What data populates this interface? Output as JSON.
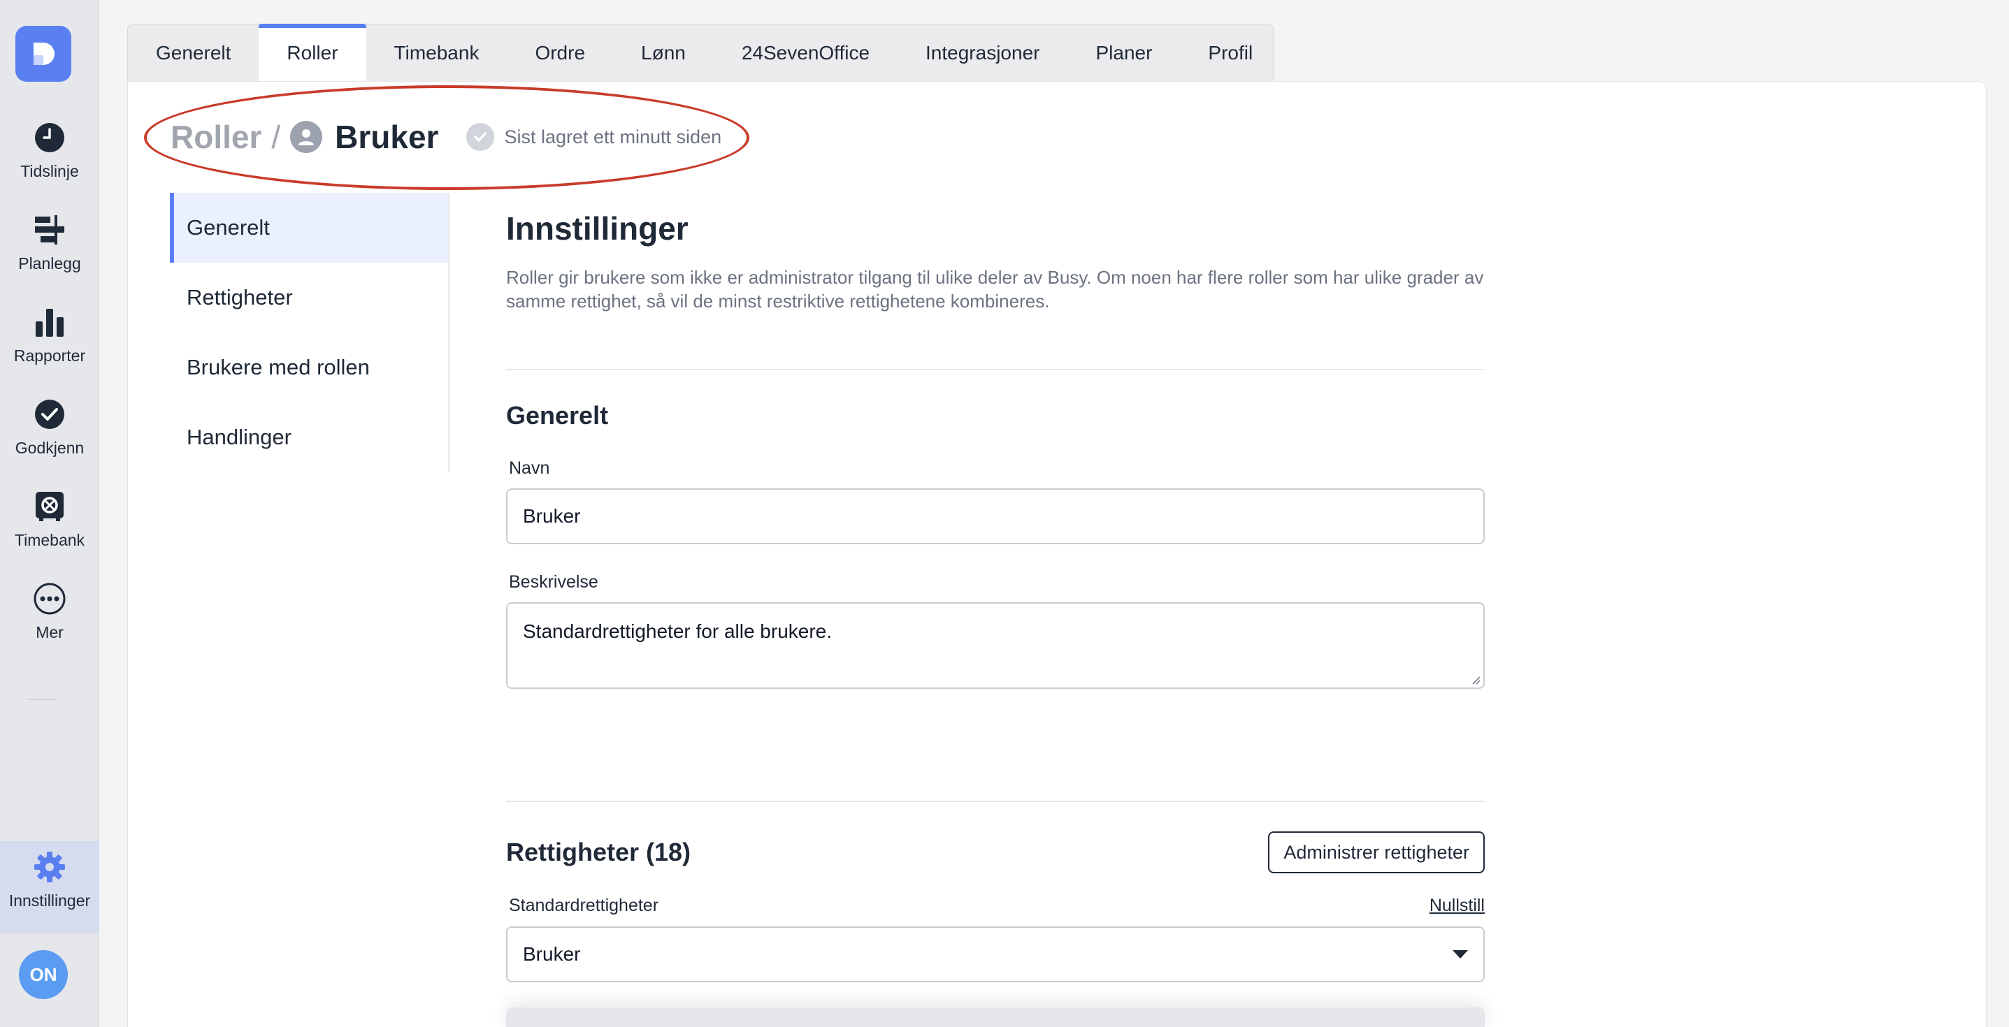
{
  "nav": {
    "items": [
      {
        "label": "Tidslinje",
        "icon": "clock-icon"
      },
      {
        "label": "Planlegg",
        "icon": "planning-icon"
      },
      {
        "label": "Rapporter",
        "icon": "bar-chart-icon"
      },
      {
        "label": "Godkjenn",
        "icon": "check-circle-icon"
      },
      {
        "label": "Timebank",
        "icon": "safe-icon"
      },
      {
        "label": "Mer",
        "icon": "more-icon"
      }
    ],
    "settings_label": "Innstillinger",
    "avatar_initials": "ON"
  },
  "tabs": [
    "Generelt",
    "Roller",
    "Timebank",
    "Ordre",
    "Lønn",
    "24SevenOffice",
    "Integrasjoner",
    "Planer",
    "Profil"
  ],
  "header": {
    "crumb_root": "Roller",
    "crumb_sep": "/",
    "crumb_current": "Bruker",
    "saved_status": "Sist lagret ett minutt siden"
  },
  "subnav": [
    "Generelt",
    "Rettigheter",
    "Brukere med rollen",
    "Handlinger"
  ],
  "settings": {
    "title": "Innstillinger",
    "description": "Roller gir brukere som ikke er administrator tilgang til ulike deler av Busy. Om noen har flere roller som har ulike grader av samme rettighet, så vil de minst restriktive rettighetene kombineres."
  },
  "general": {
    "title": "Generelt",
    "name_label": "Navn",
    "name_value": "Bruker",
    "desc_label": "Beskrivelse",
    "desc_value": "Standardrettigheter for alle brukere."
  },
  "permissions": {
    "title": "Rettigheter (18)",
    "manage_button": "Administrer rettigheter",
    "default_label": "Standardrettigheter",
    "reset_link": "Nullstill",
    "default_value": "Bruker"
  },
  "colors": {
    "accent": "#5a7ff0",
    "highlight_ellipse": "#c93b2a"
  }
}
